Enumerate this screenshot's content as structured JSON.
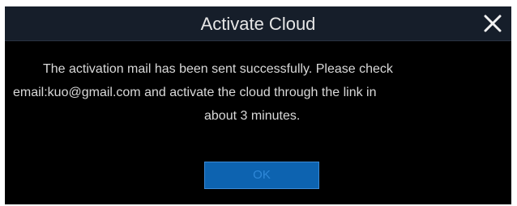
{
  "dialog": {
    "title": "Activate Cloud",
    "close_icon": "close-icon",
    "message_lines": [
      "The activation mail has been sent successfully. Please check",
      "email:kuo@gmail.com and activate the cloud through the link in",
      "about 3 minutes."
    ],
    "ok_label": "OK"
  },
  "colors": {
    "title_bar": "#161e2a",
    "background": "#000000",
    "button": "#0d63b0",
    "button_text": "#2f88d8",
    "text": "#d9d9d9"
  }
}
